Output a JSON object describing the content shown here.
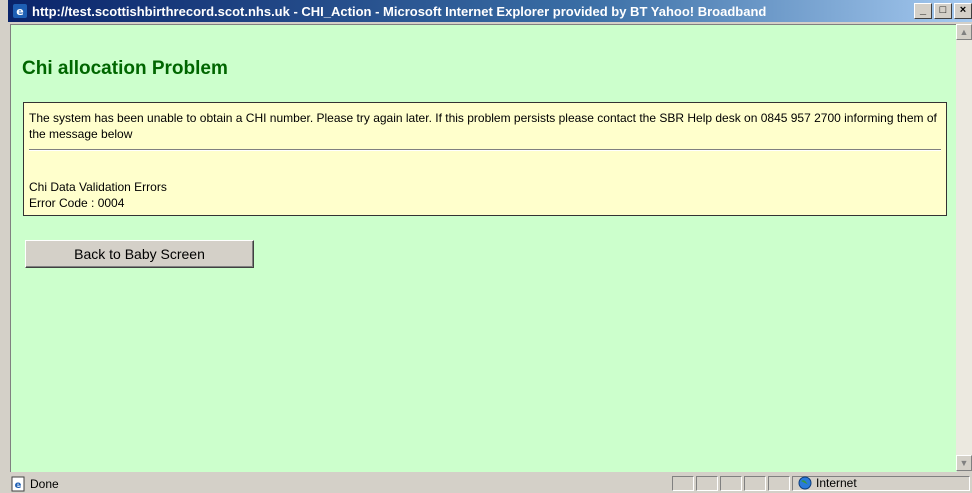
{
  "window": {
    "title": "http://test.scottishbirthrecord.scot.nhs.uk - CHI_Action - Microsoft Internet Explorer provided by BT Yahoo! Broadband",
    "minimize": "_",
    "maximize": "□",
    "close": "×"
  },
  "page": {
    "title": "Chi allocation Problem",
    "message": "The system has been unable to obtain a CHI number. Please try again later. If this problem persists please contact the SBR Help desk on 0845 957 2700 informing them of the message below",
    "error_title": "Chi Data Validation Errors",
    "error_code": "Error Code : 0004",
    "back_button": "Back to Baby Screen"
  },
  "status": {
    "text": "Done",
    "zone": "Internet"
  },
  "colors": {
    "page_bg": "#ccffcc",
    "title_color": "#006600",
    "message_bg": "#ffffcc"
  }
}
